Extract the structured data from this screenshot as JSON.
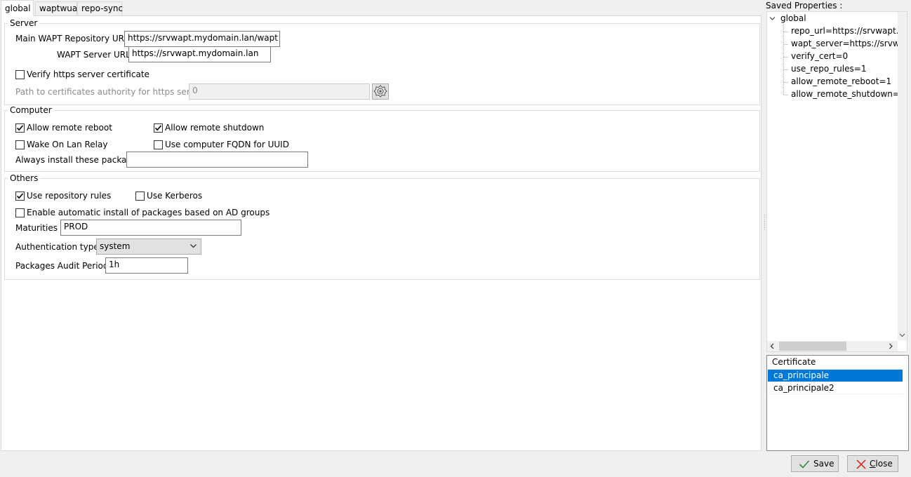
{
  "tabs": [
    {
      "label": "global",
      "active": true
    },
    {
      "label": "waptwua",
      "active": false
    },
    {
      "label": "repo-sync",
      "active": false
    }
  ],
  "server": {
    "title": "Server",
    "repo_url_label": "Main WAPT Repository URL :",
    "repo_url_value": "https://srvwapt.mydomain.lan/wapt",
    "server_url_label": "WAPT Server URL :",
    "server_url_value": "https://srvwapt.mydomain.lan",
    "verify_cert_label": "Verify https server certificate",
    "verify_cert_checked": false,
    "ca_path_label": "Path to certificates authority for https servers :",
    "ca_path_value": "0"
  },
  "computer": {
    "title": "Computer",
    "allow_reboot_label": "Allow remote reboot",
    "allow_reboot_checked": true,
    "allow_shutdown_label": "Allow remote shutdown",
    "allow_shutdown_checked": true,
    "wol_label": "Wake On Lan Relay",
    "wol_checked": false,
    "fqdn_label": "Use computer FQDN for UUID",
    "fqdn_checked": false,
    "always_install_label": "Always install these packages",
    "always_install_value": ""
  },
  "others": {
    "title": "Others",
    "repo_rules_label": "Use repository rules",
    "repo_rules_checked": true,
    "kerberos_label": "Use Kerberos",
    "kerberos_checked": false,
    "ad_groups_label": "Enable automatic install of packages based on AD groups",
    "ad_groups_checked": false,
    "maturities_label": "Maturities :",
    "maturities_value": "PROD",
    "auth_type_label": "Authentication type :",
    "auth_type_value": "system",
    "audit_period_label": "Packages Audit Period :",
    "audit_period_value": "1h"
  },
  "saved": {
    "title": "Saved Properties :",
    "root": "global",
    "items": [
      "repo_url=https://srvwapt.my",
      "wapt_server=https://srvwapt",
      "verify_cert=0",
      "use_repo_rules=1",
      "allow_remote_reboot=1",
      "allow_remote_shutdown=1"
    ]
  },
  "certificates": {
    "header": "Certificate",
    "rows": [
      {
        "name": "ca_principale",
        "selected": true
      },
      {
        "name": "ca_principale2",
        "selected": false
      }
    ]
  },
  "buttons": {
    "save": "Save",
    "close_prefix": "C",
    "close_rest": "lose"
  },
  "colors": {
    "selection": "#0078d7",
    "save_check": "#2e8b3c",
    "close_x": "#d32f2f"
  }
}
